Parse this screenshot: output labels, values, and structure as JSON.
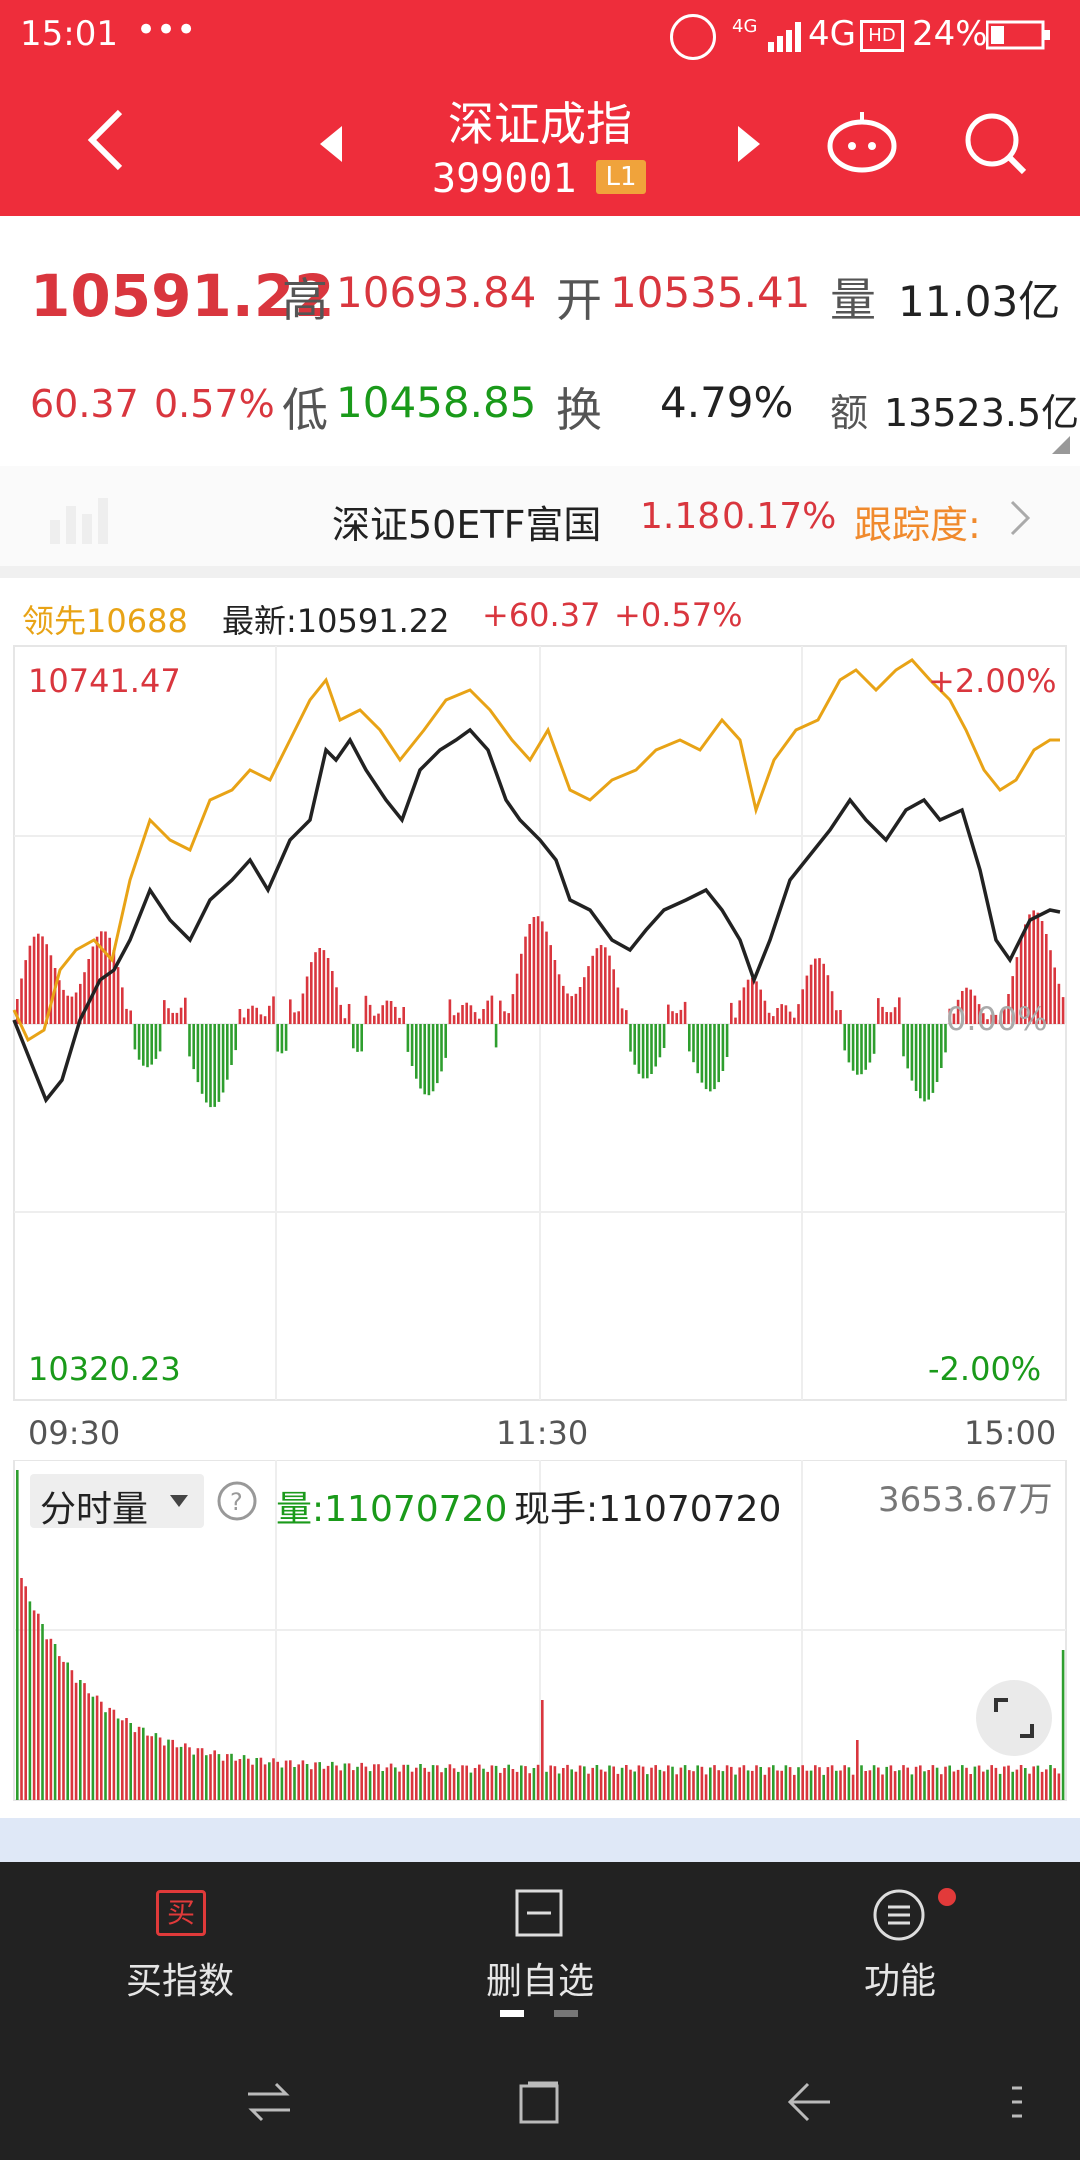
{
  "status_bar": {
    "time": "15:01",
    "dots": "•••",
    "network": "4G",
    "battery": "24%"
  },
  "header": {
    "title": "深证成指",
    "code": "399001",
    "level": "L1"
  },
  "quote": {
    "price": "10591.22",
    "change": "60.37",
    "change_pct": "0.57%",
    "high_label": "高",
    "high": "10693.84",
    "open_label": "开",
    "open": "10535.41",
    "volume_label": "量",
    "volume": "11.03亿",
    "low_label": "低",
    "low": "10458.85",
    "turnover_label": "换",
    "turnover": "4.79%",
    "amount_label": "额",
    "amount": "13523.5亿"
  },
  "etf": {
    "name": "深证50ETF富国",
    "price": "1.18",
    "pct": "0.17%",
    "track_label": "跟踪度:"
  },
  "intraday": {
    "lead_label": "领先10688",
    "latest": "最新:10591.22",
    "chg": "+60.37",
    "chg_pct": "+0.57%",
    "y_top": "10741.47",
    "y_bottom": "10320.23",
    "pct_top": "+2.00%",
    "pct_bottom": "-2.00%",
    "pct_mid": "0.00%",
    "x_start": "09:30",
    "x_mid": "11:30",
    "x_end": "15:00",
    "colors": {
      "lead": "#e8a316",
      "price": "#222222",
      "up": "#d9363e",
      "down": "#2e9e2e"
    }
  },
  "volume_panel": {
    "selector": "分时量",
    "help_icon": "question-icon",
    "vol_label": "量:11070720",
    "now_label": "现手:11070720",
    "max_label": "3653.67万"
  },
  "tabbar": {
    "buy_label": "买指数",
    "buy_icon_text": "买",
    "watch_label": "删自选",
    "func_label": "功能"
  },
  "chart_data": {
    "type": "line",
    "x_labels": [
      "09:30",
      "11:30",
      "15:00"
    ],
    "ylim": [
      10320.23,
      10741.47
    ],
    "pct_lim": [
      "-2.00%",
      "+2.00%"
    ]
  }
}
